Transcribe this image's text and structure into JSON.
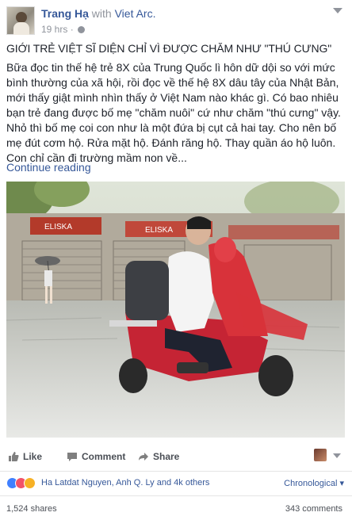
{
  "post": {
    "author": "Trang Hạ",
    "with_text": "with",
    "with_name": "Viet Arc.",
    "time": "19 hrs",
    "title": "GIỚI TRẺ VIỆT SĨ DIỆN CHỈ VÌ ĐƯỢC CHĂM NHƯ \"THÚ CƯNG\"",
    "paragraph1": "Bữa đọc tin thế hệ trẻ 8X của Trung Quốc lì hôn dữ dội so với mức bình thường của xã hội, rồi đọc về thế hệ 8X dâu tây của Nhật Bản, mới thấy giật mình nhìn thấy ở Việt Nam nào khác gì. Có bao nhiêu bạn trẻ đang được bố mẹ \"chăm nuôi\" cứ như chăm \"thú cưng\" vậy.",
    "paragraph2": "Nhỏ thì bố mẹ coi con như là một đứa bị cụt cả hai tay. Cho nên bố mẹ đút cơm hộ. Rửa mặt hộ. Đánh răng hộ. Thay quần áo hộ luôn. Con chỉ cần đi trường mầm non về...",
    "continue_label": "Continue reading",
    "photo_sign_left": "ELISKA",
    "photo_sign_right": "ELISKA"
  },
  "actions": {
    "like": "Like",
    "comment": "Comment",
    "share": "Share"
  },
  "reactions": {
    "names": "Ha Latdat Nguyen, Anh Q. Ly and 4k others",
    "sort": "Chronological"
  },
  "stats": {
    "shares": "1,524 shares",
    "comments": "343 comments"
  },
  "colors": {
    "link": "#365899",
    "like": "#4080ff",
    "love": "#f25268",
    "sad": "#f7b125"
  }
}
